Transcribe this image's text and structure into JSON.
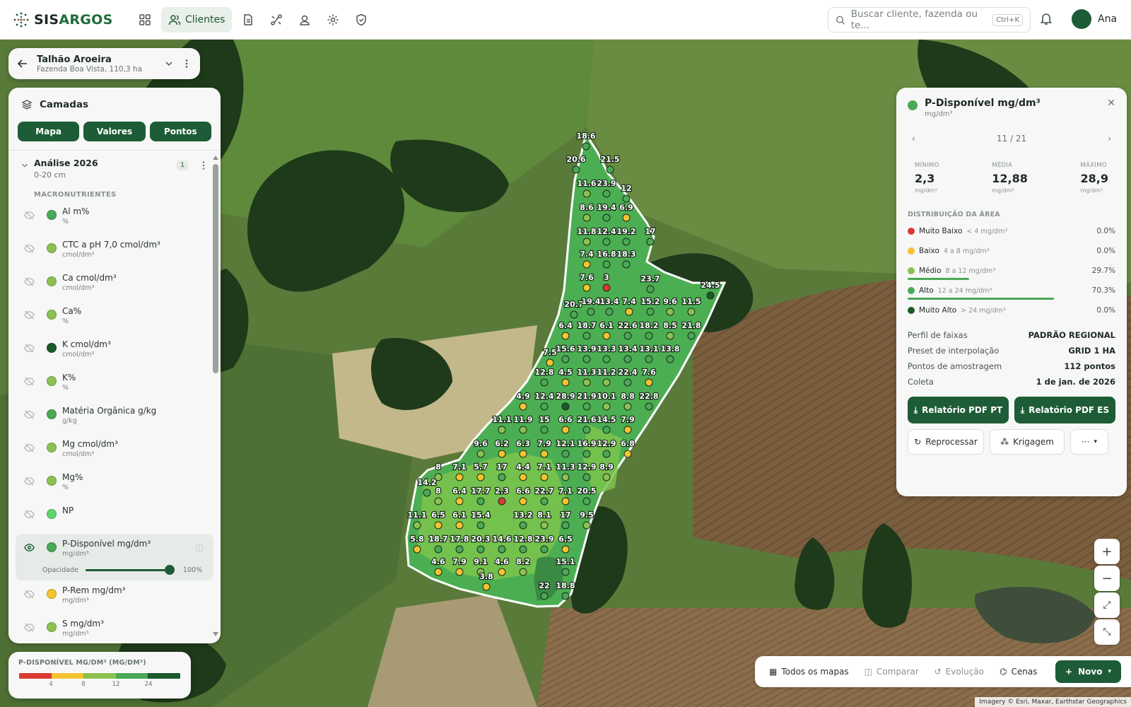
{
  "brand": {
    "name_a": "SIS",
    "name_b": "ARGOS"
  },
  "nav": {
    "active_label": "Clientes"
  },
  "search": {
    "placeholder": "Buscar cliente, fazenda ou te...",
    "shortcut": "Ctrl+K"
  },
  "user": {
    "name": "Ana"
  },
  "plot": {
    "title": "Talhão Aroeira",
    "subtitle": "Fazenda Boa Vista, 110,3 ha"
  },
  "layers_panel": {
    "title": "Camadas",
    "tabs": [
      "Mapa",
      "Valores",
      "Pontos"
    ],
    "group": {
      "title": "Análise 2026",
      "depth": "0-20 cm",
      "badge": "1"
    },
    "section": "MACRONUTRIENTES",
    "items": [
      {
        "name": "Al m%",
        "unit": "%",
        "color": "#4aa857"
      },
      {
        "name": "CTC a pH 7,0 cmol/dm³",
        "unit": "cmol/dm³",
        "color": "#8cc152"
      },
      {
        "name": "Ca cmol/dm³",
        "unit": "cmol/dm³",
        "color": "#8cc152"
      },
      {
        "name": "Ca%",
        "unit": "%",
        "color": "#8cc152"
      },
      {
        "name": "K cmol/dm³",
        "unit": "cmol/dm³",
        "color": "#1a5a2a"
      },
      {
        "name": "K%",
        "unit": "%",
        "color": "#8cc152"
      },
      {
        "name": "Matéria Orgânica g/kg",
        "unit": "g/kg",
        "color": "#4aa857"
      },
      {
        "name": "Mg cmol/dm³",
        "unit": "cmol/dm³",
        "color": "#8cc152"
      },
      {
        "name": "Mg%",
        "unit": "%",
        "color": "#8cc152"
      },
      {
        "name": "NP",
        "unit": "",
        "color": "#5fd46a"
      },
      {
        "name": "P-Disponível mg/dm³",
        "unit": "mg/dm³",
        "color": "#4aa857"
      },
      {
        "name": "P-Rem mg/dm³",
        "unit": "mg/dm³",
        "color": "#f4c430"
      },
      {
        "name": "S mg/dm³",
        "unit": "mg/dm³",
        "color": "#8cc152"
      }
    ],
    "opacity_label": "Opacidade",
    "opacity_value": "100%"
  },
  "legend": {
    "title": "P-DISPONÍVEL MG/DM³ (MG/DM³)",
    "colors": [
      "#d93a34",
      "#f4c430",
      "#8cc152",
      "#4aa857",
      "#1a5a2a"
    ],
    "ticks": [
      "4",
      "8",
      "12",
      "24"
    ]
  },
  "info": {
    "title": "P-Disponível mg/dm³",
    "unit": "mg/dm³",
    "pager": "11 / 21",
    "stats": [
      {
        "label": "MÍNIMO",
        "value": "2,3",
        "unit": "mg/dm³"
      },
      {
        "label": "MÉDIA",
        "value": "12,88",
        "unit": "mg/dm³"
      },
      {
        "label": "MÁXIMO",
        "value": "28,9",
        "unit": "mg/dm³"
      }
    ],
    "dist_title": "DISTRIBUIÇÃO DA ÁREA",
    "distribution": [
      {
        "name": "Muito Baixo",
        "range": "< 4 mg/dm³",
        "pct": "0.0%",
        "share": 0.0,
        "color": "#d93a34"
      },
      {
        "name": "Baixo",
        "range": "4 a 8 mg/dm³",
        "pct": "0.0%",
        "share": 0.0,
        "color": "#f4c430"
      },
      {
        "name": "Médio",
        "range": "8 a 12 mg/dm³",
        "pct": "29.7%",
        "share": 0.297,
        "color": "#8cc152"
      },
      {
        "name": "Alto",
        "range": "12 a 24 mg/dm³",
        "pct": "70.3%",
        "share": 0.703,
        "color": "#4aa857"
      },
      {
        "name": "Muito Alto",
        "range": "> 24 mg/dm³",
        "pct": "0.0%",
        "share": 0.0,
        "color": "#1a5a2a"
      }
    ],
    "details": [
      {
        "k": "Perfil de faixas",
        "v": "PADRÃO REGIONAL"
      },
      {
        "k": "Preset de interpolação",
        "v": "GRID 1 HA"
      },
      {
        "k": "Pontos de amostragem",
        "v": "112 pontos"
      },
      {
        "k": "Coleta",
        "v": "1 de jan. de 2026"
      }
    ],
    "btn_pdf_pt": "Relatório PDF PT",
    "btn_pdf_es": "Relatório PDF ES",
    "btn_reprocess": "Reprocessar",
    "btn_kriging": "Krigagem"
  },
  "bottombar": {
    "all_maps": "Todos os mapas",
    "compare": "Comparar",
    "evolution": "Evolução",
    "scenes": "Cenas",
    "new": "Novo"
  },
  "attribution": "Imagery © Esri, Maxar, Earthstar Geographics",
  "samples": [
    [
      "18.6",
      "#4aa857"
    ],
    [
      "20.6",
      "#4aa857"
    ],
    [
      "21.5",
      "#4aa857"
    ],
    [
      "11.6",
      "#8cc152"
    ],
    [
      "23.9",
      "#4aa857"
    ],
    [
      "12",
      "#4aa857"
    ],
    [
      "8.6",
      "#8cc152"
    ],
    [
      "19.4",
      "#4aa857"
    ],
    [
      "6.9",
      "#f4c430"
    ],
    [
      "11.8",
      "#8cc152"
    ],
    [
      "12.4",
      "#4aa857"
    ],
    [
      "19.2",
      "#4aa857"
    ],
    [
      "17",
      "#4aa857"
    ],
    [
      "7.4",
      "#f4c430"
    ],
    [
      "16.8",
      "#4aa857"
    ],
    [
      "18.3",
      "#4aa857"
    ],
    [
      "7.6",
      "#f4c430"
    ],
    [
      "3",
      "#d93a34"
    ],
    [
      "23.7",
      "#4aa857"
    ],
    [
      "24.5",
      "#1a5a2a"
    ],
    [
      "20.7",
      "#4aa857"
    ],
    [
      "19.4",
      "#4aa857"
    ],
    [
      "13.4",
      "#4aa857"
    ],
    [
      "7.4",
      "#f4c430"
    ],
    [
      "15.2",
      "#4aa857"
    ],
    [
      "9.6",
      "#8cc152"
    ],
    [
      "11.5",
      "#8cc152"
    ],
    [
      "6.4",
      "#f4c430"
    ],
    [
      "18.7",
      "#4aa857"
    ],
    [
      "6.1",
      "#f4c430"
    ],
    [
      "22.6",
      "#4aa857"
    ],
    [
      "18.2",
      "#4aa857"
    ],
    [
      "8.5",
      "#8cc152"
    ],
    [
      "21.8",
      "#4aa857"
    ],
    [
      "7.5",
      "#f4c430"
    ],
    [
      "15.6",
      "#4aa857"
    ],
    [
      "13.9",
      "#4aa857"
    ],
    [
      "13.3",
      "#4aa857"
    ],
    [
      "13.4",
      "#4aa857"
    ],
    [
      "13.1",
      "#4aa857"
    ],
    [
      "13.8",
      "#4aa857"
    ],
    [
      "12.8",
      "#4aa857"
    ],
    [
      "4.5",
      "#f4c430"
    ],
    [
      "11.3",
      "#8cc152"
    ],
    [
      "11.2",
      "#8cc152"
    ],
    [
      "22.4",
      "#4aa857"
    ],
    [
      "7.6",
      "#f4c430"
    ],
    [
      "4.9",
      "#f4c430"
    ],
    [
      "12.4",
      "#4aa857"
    ],
    [
      "28.9",
      "#1a5a2a"
    ],
    [
      "21.9",
      "#4aa857"
    ],
    [
      "10.1",
      "#8cc152"
    ],
    [
      "8.8",
      "#8cc152"
    ],
    [
      "22.8",
      "#4aa857"
    ],
    [
      "11.1",
      "#8cc152"
    ],
    [
      "11.9",
      "#8cc152"
    ],
    [
      "15",
      "#4aa857"
    ],
    [
      "6.6",
      "#f4c430"
    ],
    [
      "21.6",
      "#4aa857"
    ],
    [
      "14.5",
      "#4aa857"
    ],
    [
      "7.9",
      "#f4c430"
    ],
    [
      "9.6",
      "#8cc152"
    ],
    [
      "6.2",
      "#f4c430"
    ],
    [
      "6.3",
      "#f4c430"
    ],
    [
      "7.9",
      "#f4c430"
    ],
    [
      "12.1",
      "#4aa857"
    ],
    [
      "16.9",
      "#4aa857"
    ],
    [
      "12.9",
      "#4aa857"
    ],
    [
      "6.8",
      "#f4c430"
    ],
    [
      "8",
      "#8cc152"
    ],
    [
      "7.1",
      "#f4c430"
    ],
    [
      "5.7",
      "#f4c430"
    ],
    [
      "17",
      "#4aa857"
    ],
    [
      "4.4",
      "#f4c430"
    ],
    [
      "7.1",
      "#f4c430"
    ],
    [
      "11.3",
      "#8cc152"
    ],
    [
      "12.9",
      "#4aa857"
    ],
    [
      "8.9",
      "#8cc152"
    ],
    [
      "14.2",
      "#4aa857"
    ],
    [
      "8",
      "#8cc152"
    ],
    [
      "6.4",
      "#f4c430"
    ],
    [
      "17.7",
      "#4aa857"
    ],
    [
      "2.3",
      "#d93a34"
    ],
    [
      "6.6",
      "#f4c430"
    ],
    [
      "22.7",
      "#4aa857"
    ],
    [
      "7.1",
      "#f4c430"
    ],
    [
      "20.5",
      "#4aa857"
    ],
    [
      "11.1",
      "#8cc152"
    ],
    [
      "6.5",
      "#f4c430"
    ],
    [
      "6.1",
      "#f4c430"
    ],
    [
      "15.4",
      "#4aa857"
    ],
    [
      "13.2",
      "#4aa857"
    ],
    [
      "8.1",
      "#8cc152"
    ],
    [
      "17",
      "#4aa857"
    ],
    [
      "9.5",
      "#8cc152"
    ],
    [
      "5.8",
      "#f4c430"
    ],
    [
      "18.7",
      "#4aa857"
    ],
    [
      "17.8",
      "#4aa857"
    ],
    [
      "20.3",
      "#4aa857"
    ],
    [
      "14.6",
      "#4aa857"
    ],
    [
      "12.8",
      "#4aa857"
    ],
    [
      "23.9",
      "#4aa857"
    ],
    [
      "6.5",
      "#f4c430"
    ],
    [
      "4.6",
      "#f4c430"
    ],
    [
      "7.9",
      "#f4c430"
    ],
    [
      "9.1",
      "#8cc152"
    ],
    [
      "4.6",
      "#f4c430"
    ],
    [
      "8.2",
      "#8cc152"
    ],
    [
      "15.1",
      "#4aa857"
    ],
    [
      "3.8",
      "#f4c430"
    ],
    [
      "22",
      "#4aa857"
    ],
    [
      "18.8",
      "#4aa857"
    ]
  ]
}
